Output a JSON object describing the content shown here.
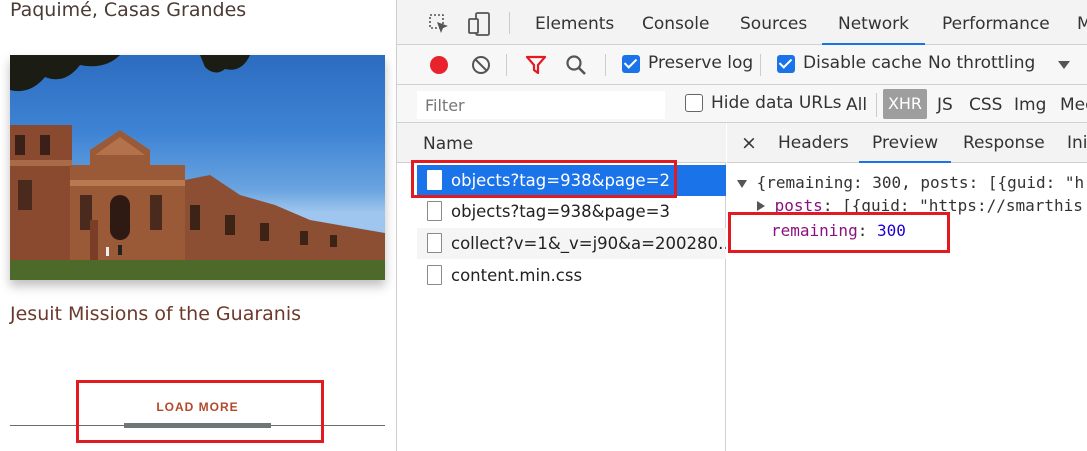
{
  "site": {
    "previous_title": "Paquimé, Casas Grandes",
    "card_title": "Jesuit Missions of the Guaranis",
    "load_more": "LOAD MORE"
  },
  "devtools": {
    "tabs": [
      "Elements",
      "Console",
      "Sources",
      "Network",
      "Performance",
      "M"
    ],
    "active_tab": "Network",
    "toolbar": {
      "preserve_log": "Preserve log",
      "disable_cache": "Disable cache",
      "throttling": "No throttling"
    },
    "filter": {
      "placeholder": "Filter",
      "hide_data_urls": "Hide data URLs",
      "types": [
        "All",
        "XHR",
        "JS",
        "CSS",
        "Img",
        "Med"
      ],
      "active_type": "XHR"
    },
    "requests": {
      "header": "Name",
      "items": [
        "objects?tag=938&page=2",
        "objects?tag=938&page=3",
        "collect?v=1&_v=j90&a=200280…",
        "content.min.css"
      ],
      "selected_index": 0
    },
    "detail": {
      "close": "×",
      "tabs": [
        "Headers",
        "Preview",
        "Response",
        "Ini"
      ],
      "active_tab": "Preview",
      "preview": {
        "summary": "{remaining: 300, posts: [{guid: \"h",
        "posts_key": "posts",
        "posts_value": "[{guid: \"https://smarthis",
        "remaining_key": "remaining",
        "remaining_value": "300"
      }
    }
  },
  "colors": {
    "highlight_box": "#e21b23",
    "accent_blue": "#1a73e8",
    "record_red": "#e8232b",
    "button_text": "#b3492a"
  }
}
